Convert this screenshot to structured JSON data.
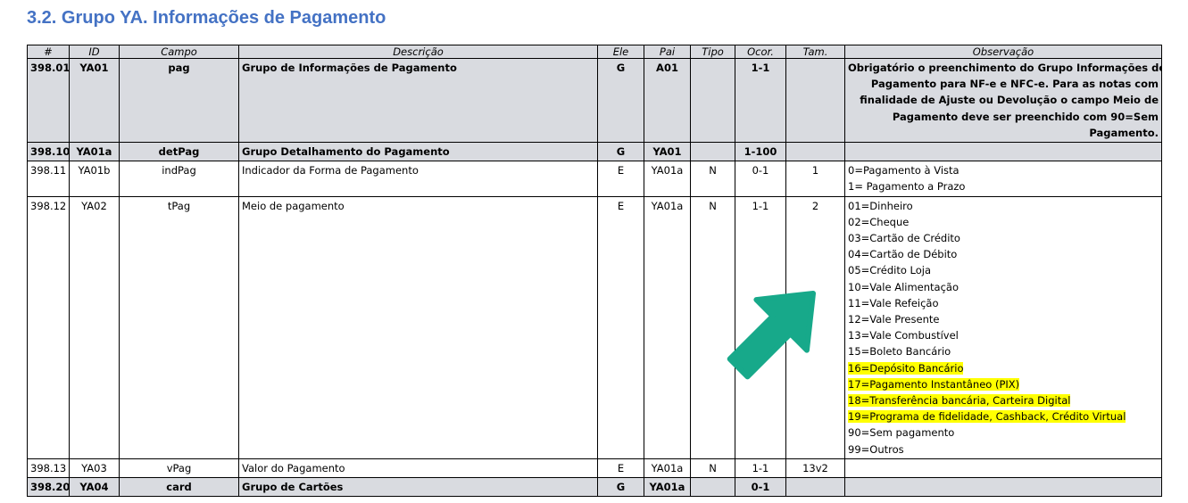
{
  "title": "3.2. Grupo YA. Informações de Pagamento",
  "colors": {
    "title": "#4472C4",
    "group_row": "#d9dbe0",
    "highlight": "#ffff00",
    "arrow": "#17a98a"
  },
  "headers": [
    "#",
    "ID",
    "Campo",
    "Descrição",
    "Ele",
    "Pai",
    "Tipo",
    "Ocor.",
    "Tam.",
    "Observação"
  ],
  "rows": [
    {
      "num": "398.01",
      "id": "YA01",
      "campo": "pag",
      "descricao": "Grupo de Informações de Pagamento",
      "ele": "G",
      "pai": "A01",
      "tipo": "",
      "ocor": "1-1",
      "tam": "",
      "obs": [
        "Obrigatório o preenchimento do Grupo Informações de",
        "Pagamento para NF-e e NFC-e. Para as notas com",
        "finalidade de Ajuste ou Devolução o campo Meio de",
        "Pagamento deve ser preenchido com 90=Sem",
        "Pagamento."
      ]
    },
    {
      "num": "398.10",
      "id": "YA01a",
      "campo": "detPag",
      "descricao": "Grupo Detalhamento do Pagamento",
      "ele": "G",
      "pai": "YA01",
      "tipo": "",
      "ocor": "1-100",
      "tam": "",
      "obs": []
    },
    {
      "num": "398.11",
      "id": "YA01b",
      "campo": "indPag",
      "descricao": "Indicador da Forma de Pagamento",
      "ele": "E",
      "pai": "YA01a",
      "tipo": "N",
      "ocor": "0-1",
      "tam": "1",
      "obs": [
        "0=Pagamento à Vista",
        "1= Pagamento a Prazo"
      ]
    },
    {
      "num": "398.12",
      "id": "YA02",
      "campo": "tPag",
      "descricao": "Meio de pagamento",
      "ele": "E",
      "pai": "YA01a",
      "tipo": "N",
      "ocor": "1-1",
      "tam": "2",
      "obs": [
        "01=Dinheiro",
        "02=Cheque",
        "03=Cartão de Crédito",
        "04=Cartão de Débito",
        "05=Crédito Loja",
        "10=Vale Alimentação",
        "11=Vale Refeição",
        "12=Vale Presente",
        "13=Vale Combustível",
        "15=Boleto Bancário",
        "16=Depósito Bancário",
        "17=Pagamento Instantâneo (PIX)",
        "18=Transferência bancária, Carteira Digital",
        "19=Programa de fidelidade, Cashback, Crédito Virtual",
        "90=Sem pagamento",
        "99=Outros"
      ],
      "highlighted": [
        10,
        11,
        12,
        13
      ]
    },
    {
      "num": "398.13",
      "id": "YA03",
      "campo": "vPag",
      "descricao": "Valor do Pagamento",
      "ele": "E",
      "pai": "YA01a",
      "tipo": "N",
      "ocor": "1-1",
      "tam": "13v2",
      "obs": []
    },
    {
      "num": "398.20",
      "id": "YA04",
      "campo": "card",
      "descricao": "Grupo de Cartões",
      "ele": "G",
      "pai": "YA01a",
      "tipo": "",
      "ocor": "0-1",
      "tam": "",
      "obs": []
    }
  ]
}
